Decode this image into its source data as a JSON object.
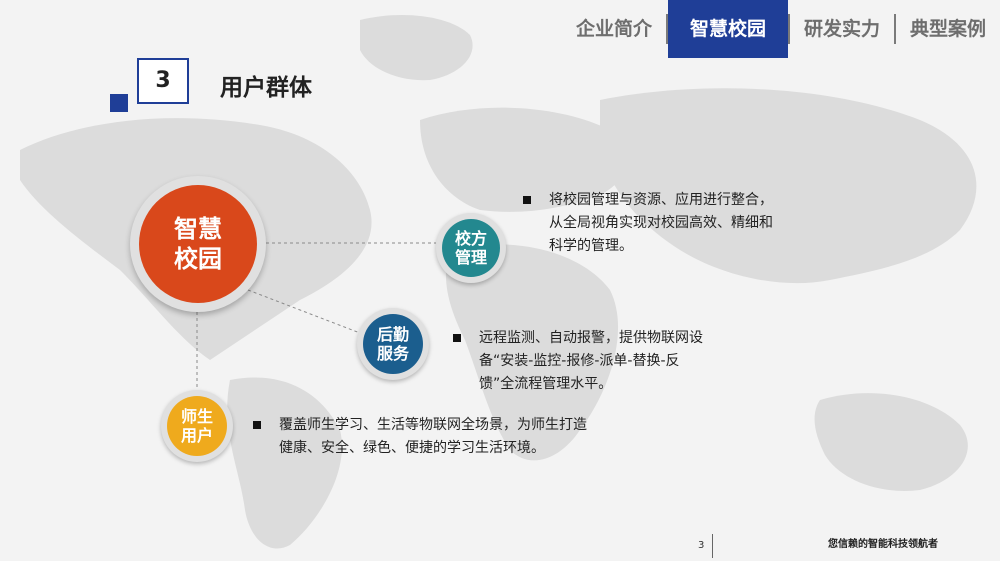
{
  "nav": {
    "items": [
      {
        "label": "企业简介",
        "active": false
      },
      {
        "label": "智慧校园",
        "active": true
      },
      {
        "label": "研发实力",
        "active": false
      },
      {
        "label": "典型案例",
        "active": false
      }
    ]
  },
  "section": {
    "number": "3",
    "title": "用户群体"
  },
  "hub": {
    "label": "智慧\n校园"
  },
  "groups": [
    {
      "label": "校方\n管理",
      "description": "将校园管理与资源、应用进行整合，从全局视角实现对校园高效、精细和科学的管理。"
    },
    {
      "label": "后勤\n服务",
      "description": "远程监测、自动报警，提供物联网设备“安装-监控-报修-派单-替换-反馈”全流程管理水平。"
    },
    {
      "label": "师生\n用户",
      "description": "覆盖师生学习、生活等物联网全场景，为师生打造健康、安全、绿色、便捷的学习生活环境。"
    }
  ],
  "footer": {
    "page": "3",
    "slogan": "您信赖的智能科技领航者"
  },
  "colors": {
    "brand": "#1f3e97",
    "hub": "#d9481b",
    "management": "#23888f",
    "logistics": "#1b5e8e",
    "users": "#efaa1d"
  }
}
